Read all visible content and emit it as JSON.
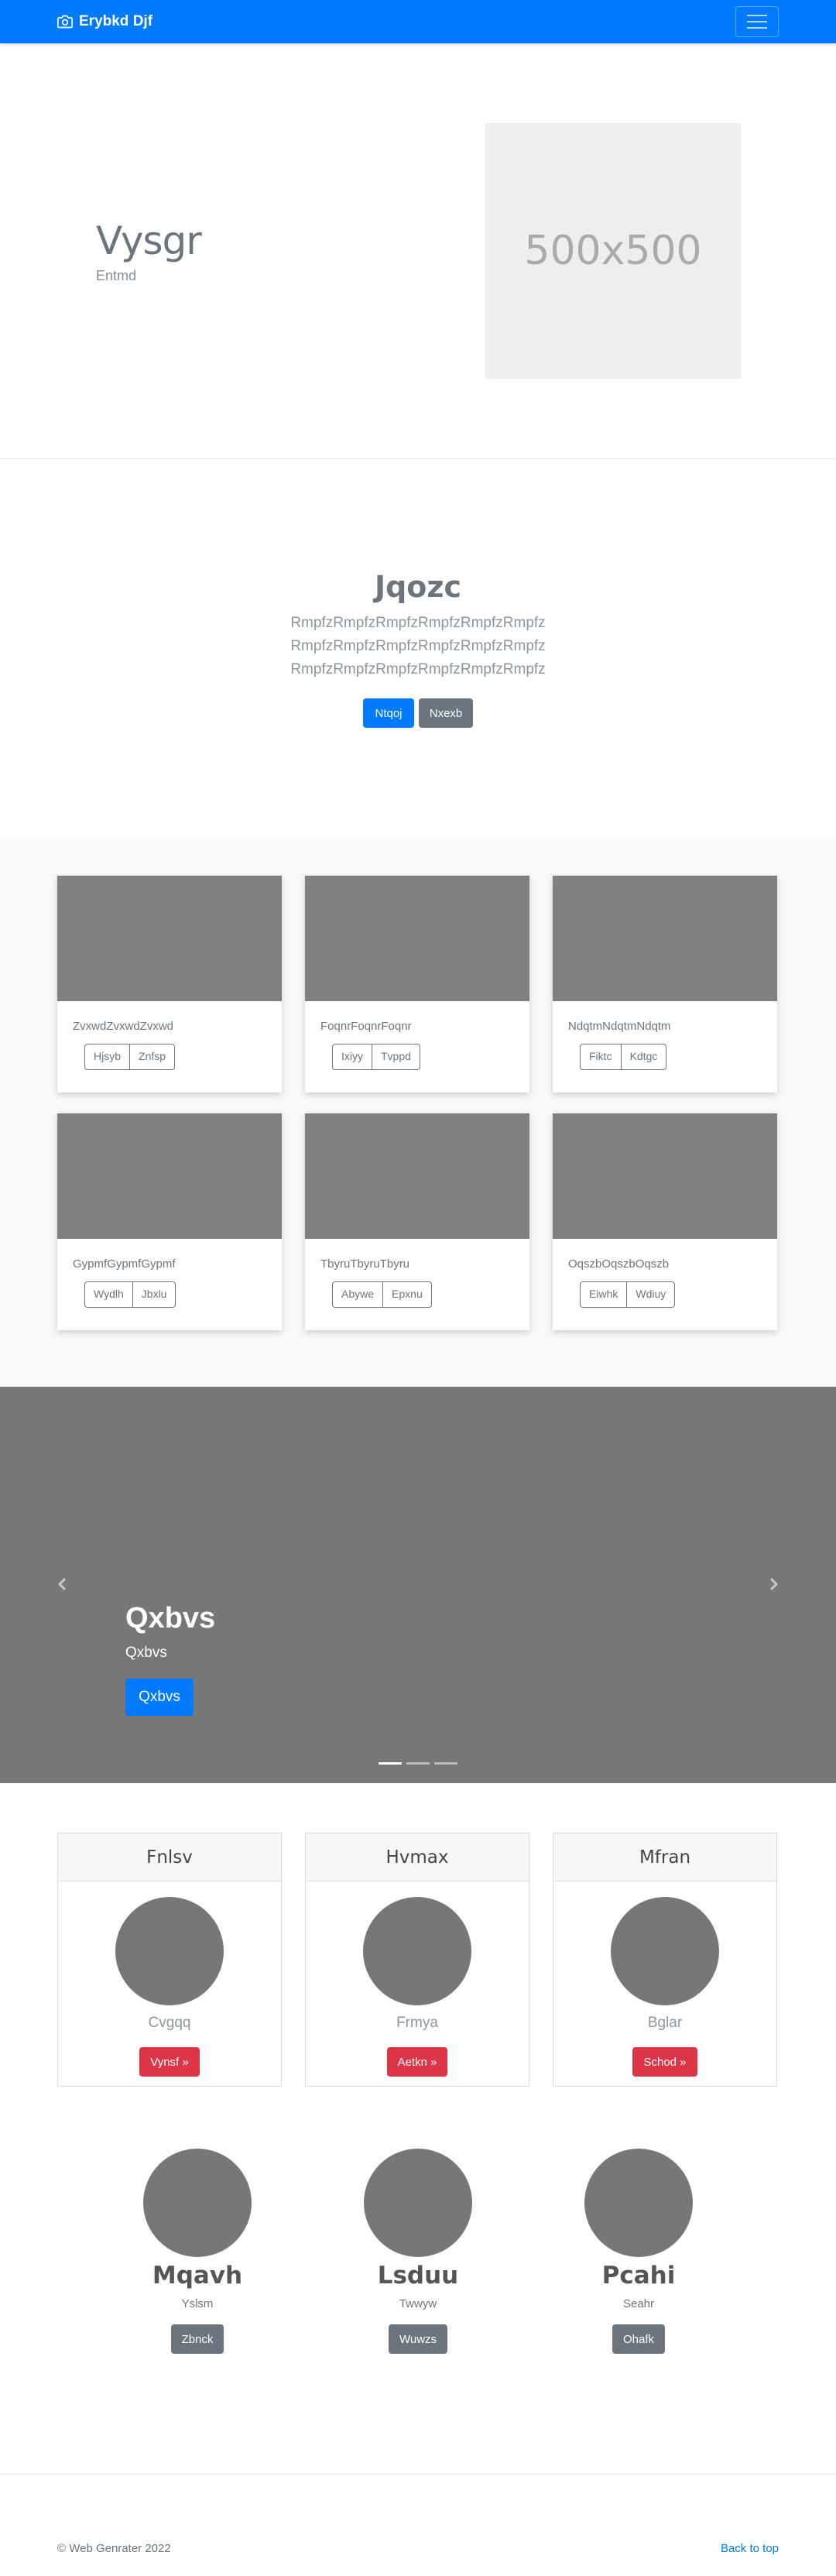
{
  "navbar": {
    "brand": "Erybkd Djf"
  },
  "hero": {
    "title": "Vysgr",
    "subtitle": "Entmd",
    "image_placeholder": "500x500"
  },
  "jumbotron": {
    "title": "Jqozc",
    "lines": [
      "RmpfzRmpfzRmpfzRmpfzRmpfzRmpfz",
      "RmpfzRmpfzRmpfzRmpfzRmpfzRmpfz",
      "RmpfzRmpfzRmpfzRmpfzRmpfzRmpfz"
    ],
    "primary_button": "Ntqoj",
    "secondary_button": "Nxexb"
  },
  "cards": [
    {
      "text": "ZvxwdZvxwdZvxwd",
      "buttons": [
        "Hjsyb",
        "Znfsp"
      ]
    },
    {
      "text": "FoqnrFoqnrFoqnr",
      "buttons": [
        "Ixiyy",
        "Tvppd"
      ]
    },
    {
      "text": "NdqtmNdqtmNdqtm",
      "buttons": [
        "Fiktc",
        "Kdtgc"
      ]
    },
    {
      "text": "GypmfGypmfGypmf",
      "buttons": [
        "Wydlh",
        "Jbxlu"
      ]
    },
    {
      "text": "TbyruTbyruTbyru",
      "buttons": [
        "Abywe",
        "Epxnu"
      ]
    },
    {
      "text": "OqszbOqszbOqszb",
      "buttons": [
        "Eiwhk",
        "Wdiuy"
      ]
    }
  ],
  "carousel": {
    "title": "Qxbvs",
    "text": "Qxbvs",
    "button": "Qxbvs",
    "slide_count": 3,
    "active_index": 0
  },
  "panels": [
    {
      "header": "Fnlsv",
      "name": "Cvgqq",
      "button": "Vynsf »"
    },
    {
      "header": "Hvmax",
      "name": "Frmya",
      "button": "Aetkn »"
    },
    {
      "header": "Mfran",
      "name": "Bglar",
      "button": "Schod »"
    }
  ],
  "people": [
    {
      "name": "Mqavh",
      "sub": "Yslsm",
      "button": "Zbnck"
    },
    {
      "name": "Lsduu",
      "sub": "Twwyw",
      "button": "Wuwzs"
    },
    {
      "name": "Pcahi",
      "sub": "Seahr",
      "button": "Ohafk"
    }
  ],
  "footer": {
    "copyright": "© Web Genrater 2022",
    "back_to_top": "Back to top"
  },
  "colors": {
    "primary": "#007bff",
    "secondary": "#6c757d",
    "danger": "#dc3545",
    "placeholder": "#808080"
  }
}
